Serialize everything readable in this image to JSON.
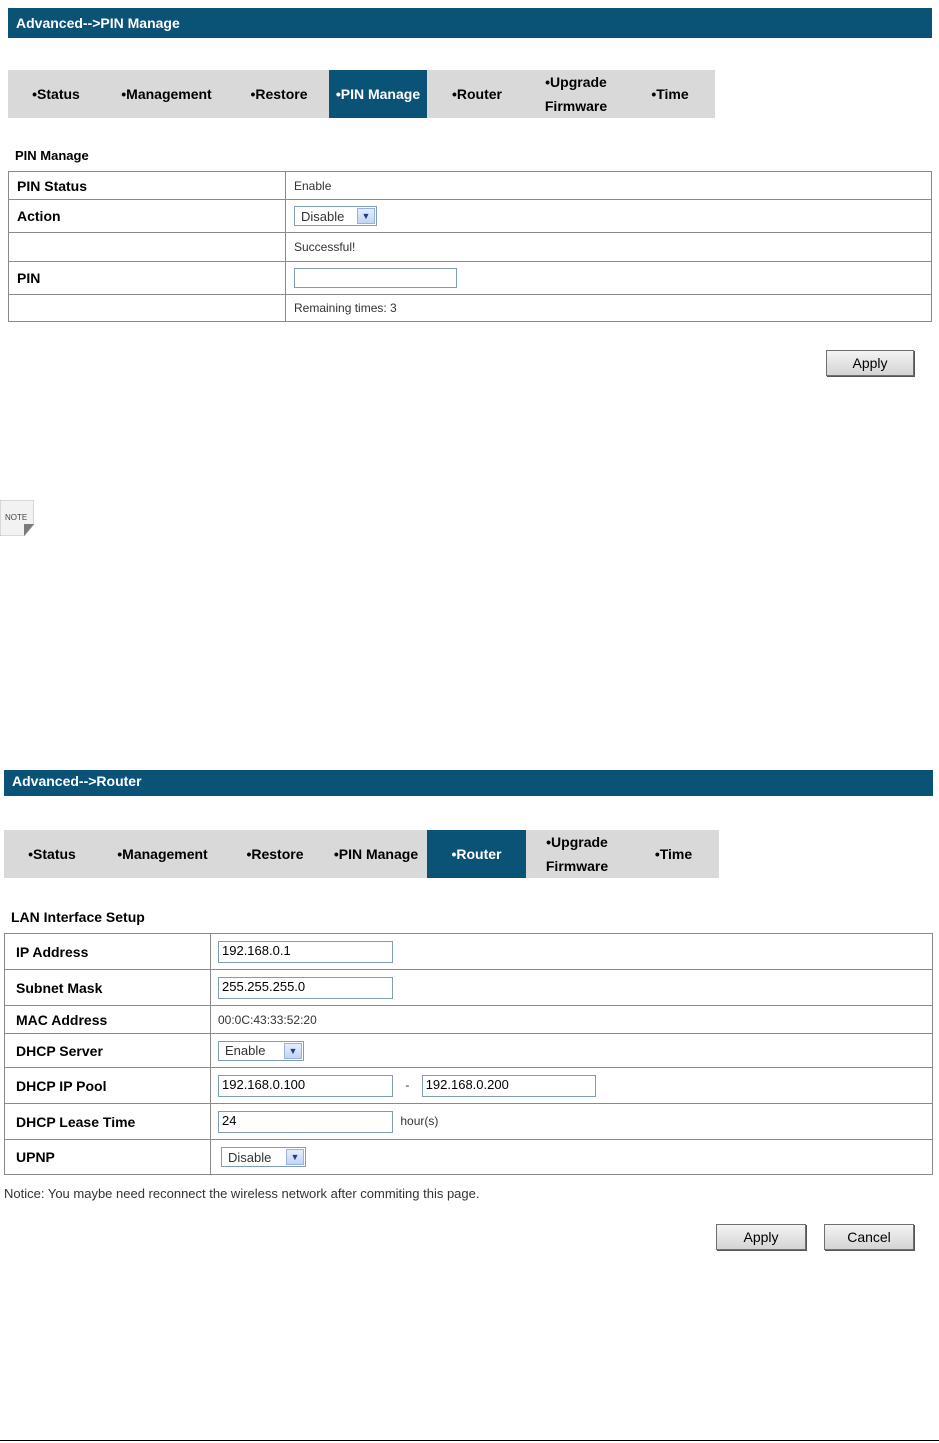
{
  "pin_section": {
    "header": "Advanced-->PIN Manage",
    "tabs": [
      "•Status",
      "•Management",
      "•Restore",
      "•PIN Manage",
      "•Router",
      "•Upgrade\nFirmware",
      "•Time"
    ],
    "active_tab": "•PIN Manage",
    "title": "PIN Manage",
    "rows": {
      "pin_status_label": "PIN Status",
      "pin_status_value": "Enable",
      "action_label": "Action",
      "action_selected": "Disable",
      "message": "Successful!",
      "pin_label": "PIN",
      "pin_value": "",
      "remaining": "Remaining times: 3"
    },
    "apply_label": "Apply"
  },
  "note_icon": {
    "text": "NOTE",
    "icon": "note-icon"
  },
  "router_section": {
    "header": "Advanced-->Router",
    "tabs": [
      "•Status",
      "•Management",
      "•Restore",
      "•PIN Manage",
      "•Router",
      "•Upgrade\nFirmware",
      "•Time"
    ],
    "active_tab": "•Router",
    "title": "LAN Interface Setup",
    "rows": {
      "ip_label": "IP Address",
      "ip_value": "192.168.0.1",
      "mask_label": "Subnet Mask",
      "mask_value": "255.255.255.0",
      "mac_label": "MAC Address",
      "mac_value": "00:0C:43:33:52:20",
      "dhcp_label": "DHCP Server",
      "dhcp_selected": "Enable",
      "pool_label": "DHCP IP Pool",
      "pool_start": "192.168.0.100",
      "pool_sep": "-",
      "pool_end": "192.168.0.200",
      "lease_label": "DHCP Lease Time",
      "lease_value": "24",
      "lease_unit": "hour(s)",
      "upnp_label": "UPNP",
      "upnp_selected": "Disable"
    },
    "notice": "Notice: You maybe need reconnect the wireless network after commiting this page.",
    "apply_label": "Apply",
    "cancel_label": "Cancel"
  },
  "colors": {
    "header_bg": "#0b5277",
    "tab_bg": "#d9d9d9",
    "active_tab_bg": "#0b5277"
  }
}
